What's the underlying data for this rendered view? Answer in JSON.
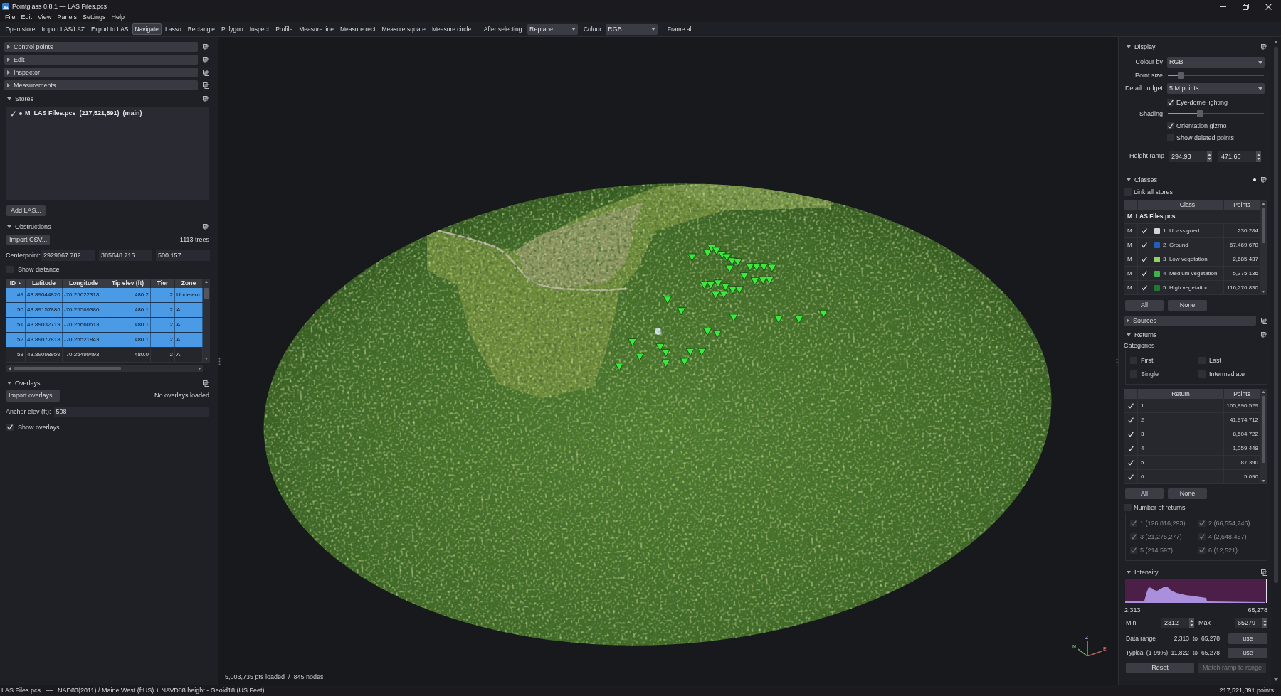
{
  "window": {
    "title": "Pointglass 0.8.1 — LAS Files.pcs"
  },
  "menu": [
    "File",
    "Edit",
    "View",
    "Panels",
    "Settings",
    "Help"
  ],
  "toolbar": {
    "actions": [
      "Open store",
      "Import LAS/LAZ",
      "Export to LAS"
    ],
    "tools": [
      {
        "label": "Navigate",
        "selected": true
      },
      {
        "label": "Lasso",
        "selected": false
      },
      {
        "label": "Rectangle",
        "selected": false
      },
      {
        "label": "Polygon",
        "selected": false
      },
      {
        "label": "Inspect",
        "selected": false
      },
      {
        "label": "Profile",
        "selected": false
      },
      {
        "label": "Measure line",
        "selected": false
      },
      {
        "label": "Measure rect",
        "selected": false
      },
      {
        "label": "Measure square",
        "selected": false
      },
      {
        "label": "Measure circle",
        "selected": false
      }
    ],
    "after_selecting": {
      "label": "After selecting:",
      "value": "Replace"
    },
    "colour": {
      "label": "Colour:",
      "value": "RGB"
    },
    "frame_all": "Frame all"
  },
  "left_panel": {
    "collapsed_sections": [
      {
        "title": "Control points",
        "expanded": false
      },
      {
        "title": "Edit",
        "expanded": false
      },
      {
        "title": "Inspector",
        "expanded": false
      },
      {
        "title": "Measurements",
        "expanded": false
      }
    ],
    "stores": {
      "title": "Stores",
      "expanded": true,
      "items": [
        {
          "checked": true,
          "label": "M  LAS Files.pcs  (217,521,891)  (main)"
        }
      ],
      "add_button": "Add LAS..."
    },
    "obstructions": {
      "title": "Obstructions",
      "expanded": true,
      "import_button": "Import CSV...",
      "count": "1113 trees",
      "centerpoint": {
        "label": "Centerpoint:",
        "values": [
          "2929067.782",
          "385648.716",
          "500.157"
        ]
      },
      "show_distance": {
        "label": "Show distance",
        "checked": false
      },
      "columns": [
        {
          "label": "ID",
          "sorted": true
        },
        {
          "label": "Latitude",
          "sorted": false
        },
        {
          "label": "Longitude",
          "sorted": false
        },
        {
          "label": "Tip elev (ft)",
          "sorted": false
        },
        {
          "label": "Tier",
          "sorted": false
        },
        {
          "label": "Zone",
          "sorted": false
        }
      ],
      "rows": [
        {
          "selected": true,
          "cells": [
            "49",
            "43.89044820",
            "-70.25622318",
            "480.2",
            "2",
            "Undeterm"
          ]
        },
        {
          "selected": true,
          "cells": [
            "50",
            "43.89157886",
            "-70.25569380",
            "480.1",
            "2",
            "A"
          ]
        },
        {
          "selected": true,
          "cells": [
            "51",
            "43.89032719",
            "-70.25660613",
            "480.1",
            "2",
            "A"
          ]
        },
        {
          "selected": true,
          "cells": [
            "52",
            "43.89077818",
            "-70.25521843",
            "480.1",
            "2",
            "A"
          ]
        },
        {
          "selected": false,
          "cells": [
            "53",
            "43.89098959",
            "-70.25499493",
            "480.0",
            "2",
            "A"
          ]
        }
      ]
    },
    "overlays": {
      "title": "Overlays",
      "expanded": true,
      "import_button": "Import overlays...",
      "status": "No overlays loaded",
      "anchor": {
        "label": "Anchor elev (ft):",
        "value": "508"
      },
      "show_overlays": {
        "label": "Show overlays",
        "checked": true
      }
    }
  },
  "viewport": {
    "status": "5,003,735 pts loaded  /  845 nodes",
    "gizmo_labels": [
      "N",
      "Z",
      "E"
    ]
  },
  "right_panel": {
    "display": {
      "title": "Display",
      "expanded": true,
      "rows": [
        {
          "kind": "dropdown",
          "label": "Colour by",
          "value": "RGB"
        },
        {
          "kind": "slider",
          "label": "Point size",
          "level": 0.13
        },
        {
          "kind": "dropdown",
          "label": "Detail budget",
          "value": "5 M points"
        },
        {
          "kind": "checkbox",
          "label": "Eye-dome lighting",
          "checked": true
        },
        {
          "kind": "slider",
          "label": "Shading",
          "level": 0.33
        },
        {
          "kind": "checkbox",
          "label": "Orientation gizmo",
          "checked": true
        },
        {
          "kind": "checkbox",
          "label": "Show deleted points",
          "checked": false
        },
        {
          "kind": "range",
          "label": "Height ramp",
          "values": [
            "294.93",
            "471.60"
          ]
        }
      ]
    },
    "classes": {
      "title": "Classes",
      "expanded": true,
      "link_all": {
        "label": "Link all stores",
        "checked": false
      },
      "columns": [
        "Class",
        "Points"
      ],
      "group": "M  LAS Files.pcs",
      "rows": [
        {
          "flag": "M",
          "checked": true,
          "color": "#d4d4d6",
          "label": "1  Unassigned",
          "points": "230,284"
        },
        {
          "flag": "M",
          "checked": true,
          "color": "#1f5fbf",
          "label": "2  Ground",
          "points": "67,469,678"
        },
        {
          "flag": "M",
          "checked": true,
          "color": "#8fd460",
          "label": "3  Low vegetation",
          "points": "2,685,437"
        },
        {
          "flag": "M",
          "checked": true,
          "color": "#3fb34a",
          "label": "4  Medium vegetation",
          "points": "5,375,136"
        },
        {
          "flag": "M",
          "checked": true,
          "color": "#1d7a2e",
          "label": "5  High vegetation",
          "points": "116,276,830"
        }
      ],
      "buttons": [
        "All",
        "None"
      ]
    },
    "sources": {
      "title": "Sources",
      "expanded": false
    },
    "returns": {
      "title": "Returns",
      "expanded": true,
      "categories_label": "Categories",
      "categories": [
        {
          "label": "First",
          "checked": false
        },
        {
          "label": "Last",
          "checked": false
        },
        {
          "label": "Single",
          "checked": false
        },
        {
          "label": "Intermediate",
          "checked": false
        }
      ],
      "columns": [
        "Return",
        "Points"
      ],
      "rows": [
        {
          "checked": true,
          "label": "1",
          "points": "165,890,529"
        },
        {
          "checked": true,
          "label": "2",
          "points": "41,974,712"
        },
        {
          "checked": true,
          "label": "3",
          "points": "8,504,722"
        },
        {
          "checked": true,
          "label": "4",
          "points": "1,059,448"
        },
        {
          "checked": true,
          "label": "5",
          "points": "87,390"
        },
        {
          "checked": true,
          "label": "6",
          "points": "5,090"
        }
      ],
      "buttons": [
        "All",
        "None"
      ],
      "number_of_returns": {
        "label": "Number of returns",
        "checked": false,
        "items": [
          {
            "label": "1 (126,816,293)",
            "checked": true,
            "disabled": true
          },
          {
            "label": "2 (66,554,746)",
            "checked": true,
            "disabled": true
          },
          {
            "label": "3 (21,275,277)",
            "checked": true,
            "disabled": true
          },
          {
            "label": "4 (2,648,457)",
            "checked": true,
            "disabled": true
          },
          {
            "label": "5 (214,597)",
            "checked": true,
            "disabled": true
          },
          {
            "label": "6 (12,521)",
            "checked": true,
            "disabled": true
          }
        ]
      }
    },
    "intensity": {
      "title": "Intensity",
      "expanded": true,
      "axis_min": "2,313",
      "axis_max": "65,278",
      "min": {
        "label": "Min",
        "value": "2312"
      },
      "max": {
        "label": "Max",
        "value": "65279"
      },
      "ranges": [
        {
          "label": "Data range",
          "from": "2,313",
          "to_word": "to",
          "to": "65,278",
          "button": "use"
        },
        {
          "label": "Typical (1-99%)",
          "from": "11,822",
          "to_word": "to",
          "to": "65,278",
          "button": "use"
        }
      ],
      "actions": [
        {
          "label": "Reset",
          "disabled": false
        },
        {
          "label": "Match ramp to range",
          "disabled": true
        }
      ]
    }
  },
  "status_bar": {
    "file": "LAS Files.pcs",
    "separator": "—",
    "crs": "NAD83(2011) / Maine West (ftUS) + NAVD88 height - Geoid18 (US Feet)",
    "points": "217,521,891 points"
  }
}
